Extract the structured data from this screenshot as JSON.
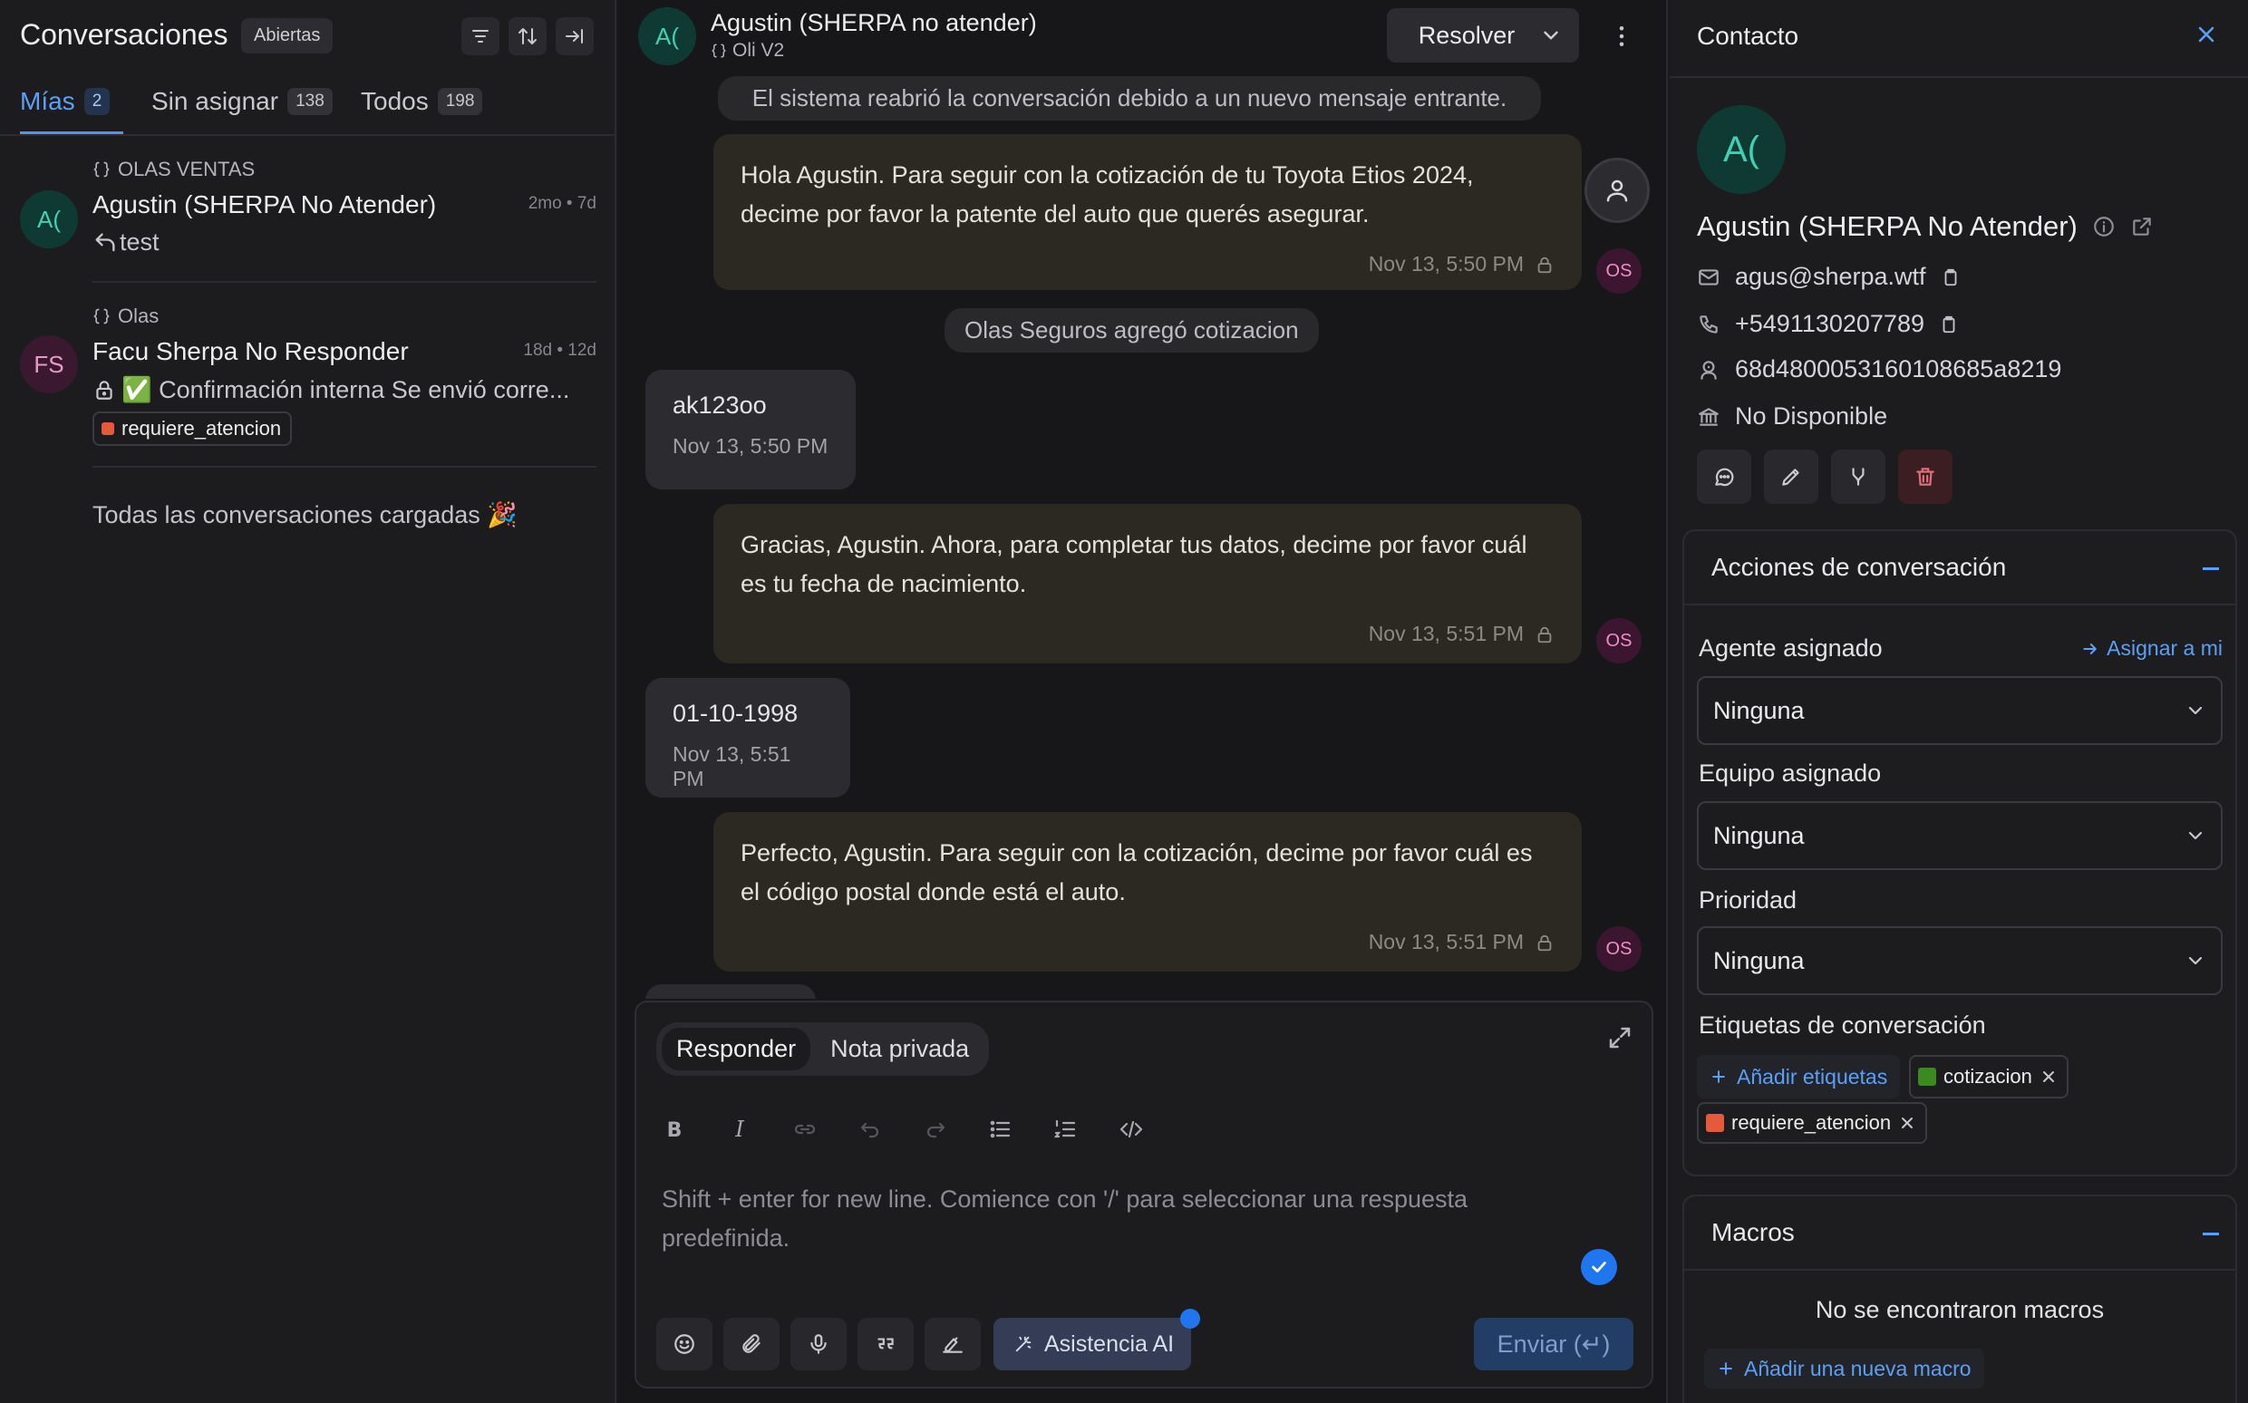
{
  "colors": {
    "accent": "#5aa0f5",
    "label_cotizacion": "#3a8a1f",
    "label_requiere_atencion": "#e45a3b",
    "send_button": "#223e66"
  },
  "left": {
    "title": "Conversaciones",
    "status_filter": "Abiertas",
    "tabs": [
      {
        "label": "Mías",
        "count": "2"
      },
      {
        "label": "Sin asignar",
        "count": "138"
      },
      {
        "label": "Todos",
        "count": "198"
      }
    ],
    "conversations": [
      {
        "inbox": "OLAS VENTAS",
        "avatar": "A(",
        "name": "Agustin (SHERPA No Atender)",
        "time": "2mo • 7d",
        "preview": "test"
      },
      {
        "inbox": "Olas",
        "avatar": "FS",
        "name": "Facu Sherpa No Responder",
        "time": "18d • 12d",
        "preview": "✅ Confirmación interna Se envió corre...",
        "label": "requiere_atencion"
      }
    ],
    "end_text": "Todas las conversaciones cargadas 🎉"
  },
  "header": {
    "avatar": "A(",
    "name": "Agustin (SHERPA no atender)",
    "inbox": "Oli V2",
    "resolve_label": "Resolver"
  },
  "messages": {
    "sys1": "El sistema reabrió la conversación debido a un nuevo mensaje entrante.",
    "m1": {
      "text": "Hola Agustin. Para seguir con la cotización de tu Toyota Etios 2024, decime por favor la patente del auto que querés asegurar.",
      "time": "Nov 13, 5:50 PM",
      "avatar": "OS"
    },
    "sys2": "Olas Seguros agregó cotizacion",
    "m2": {
      "text": "ak123oo",
      "time": "Nov 13, 5:50 PM"
    },
    "m3": {
      "text": "Gracias, Agustin. Ahora, para completar tus datos, decime por favor cuál es tu fecha de nacimiento.",
      "time": "Nov 13, 5:51 PM",
      "avatar": "OS"
    },
    "m4": {
      "text": "01-10-1998",
      "time": "Nov 13, 5:51 PM"
    },
    "m5": {
      "text": "Perfecto, Agustin. Para seguir con la cotización, decime por favor cuál es el código postal donde está el auto.",
      "time": "Nov 13, 5:51 PM",
      "avatar": "OS"
    }
  },
  "composer": {
    "mode_reply": "Responder",
    "mode_private": "Nota privada",
    "placeholder": "Shift + enter for new line. Comience con '/' para seleccionar una respuesta predefinida.",
    "ai_label": "Asistencia AI",
    "send_label": "Enviar (↵)"
  },
  "contact": {
    "panel_title": "Contacto",
    "avatar": "A(",
    "name": "Agustin (SHERPA No Atender)",
    "email": "agus@sherpa.wtf",
    "phone": "+5491130207789",
    "identifier": "68d4800053160108685a8219",
    "company": "No Disponible"
  },
  "actions": {
    "title": "Acciones de conversación",
    "agent_label": "Agente asignado",
    "assign_me": "Asignar a mi",
    "agent_value": "Ninguna",
    "team_label": "Equipo asignado",
    "team_value": "Ninguna",
    "priority_label": "Prioridad",
    "priority_value": "Ninguna",
    "labels_title": "Etiquetas de conversación",
    "add_labels": "Añadir etiquetas",
    "labels": [
      "cotizacion",
      "requiere_atencion"
    ]
  },
  "macros": {
    "title": "Macros",
    "empty": "No se encontraron macros",
    "add": "Añadir una nueva macro"
  }
}
